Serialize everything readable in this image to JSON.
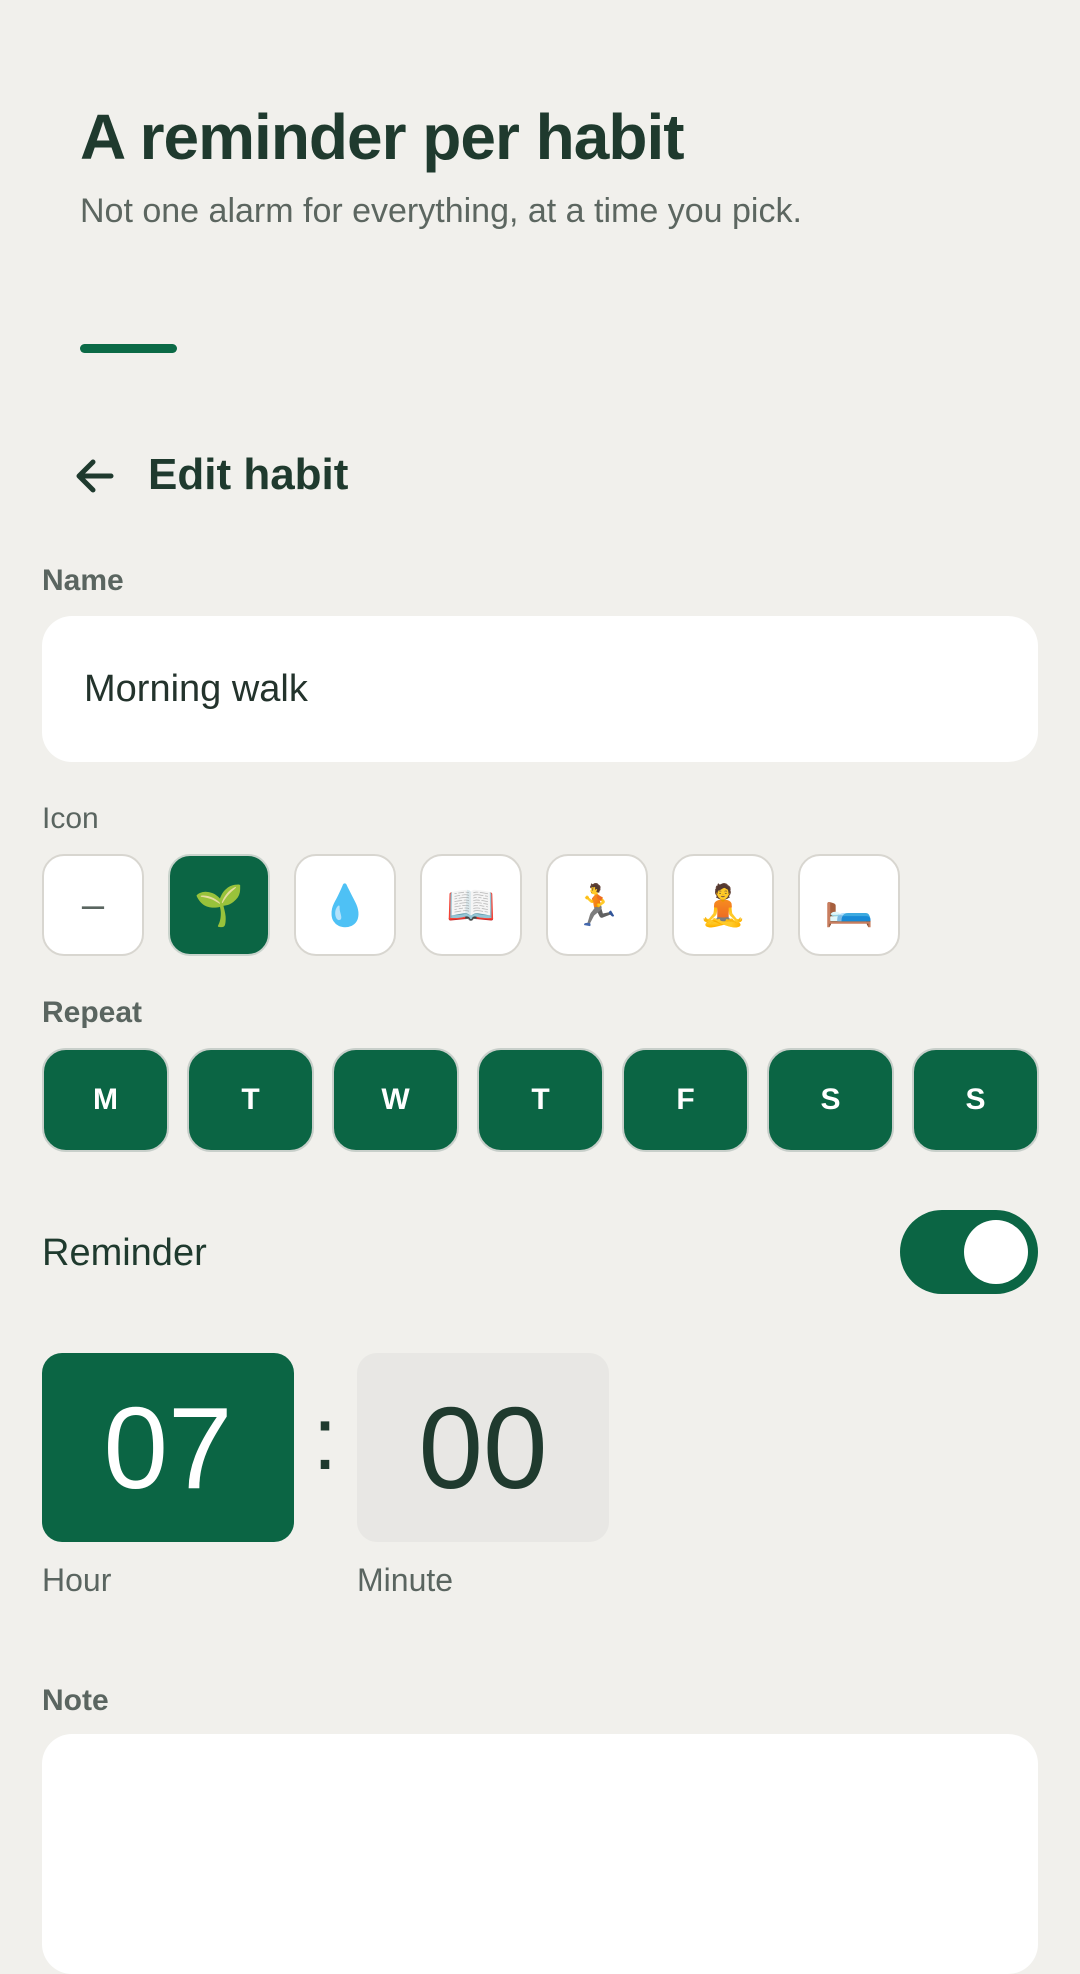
{
  "hero": {
    "title": "A reminder per habit",
    "subtitle": "Not one alarm for everything, at a time you pick."
  },
  "topbar": {
    "back_icon": "arrow-left-icon",
    "title": "Edit habit"
  },
  "form": {
    "name_label": "Name",
    "name_value": "Morning walk",
    "icon_label": "Icon",
    "icons": [
      {
        "glyph": "–",
        "name": "none",
        "selected": false
      },
      {
        "glyph": "🌱",
        "name": "seedling",
        "selected": true
      },
      {
        "glyph": "💧",
        "name": "water-drop",
        "selected": false
      },
      {
        "glyph": "📖",
        "name": "open-book",
        "selected": false
      },
      {
        "glyph": "🏃",
        "name": "runner",
        "selected": false
      },
      {
        "glyph": "🧘",
        "name": "meditation",
        "selected": false
      },
      {
        "glyph": "🛏️",
        "name": "bed",
        "selected": false
      }
    ],
    "repeat_label": "Repeat",
    "days": [
      {
        "label": "M",
        "selected": true
      },
      {
        "label": "T",
        "selected": true
      },
      {
        "label": "W",
        "selected": true
      },
      {
        "label": "T",
        "selected": true
      },
      {
        "label": "F",
        "selected": true
      },
      {
        "label": "S",
        "selected": true
      },
      {
        "label": "S",
        "selected": true
      }
    ],
    "reminder_label": "Reminder",
    "reminder_on": true,
    "time": {
      "hour": "07",
      "separator": ":",
      "minute": "00",
      "hour_caption": "Hour",
      "minute_caption": "Minute"
    },
    "note_label": "Note",
    "note_value": ""
  },
  "colors": {
    "background": "#f1f0ec",
    "accent": "#0b6544",
    "text": "#1f3a2e"
  }
}
